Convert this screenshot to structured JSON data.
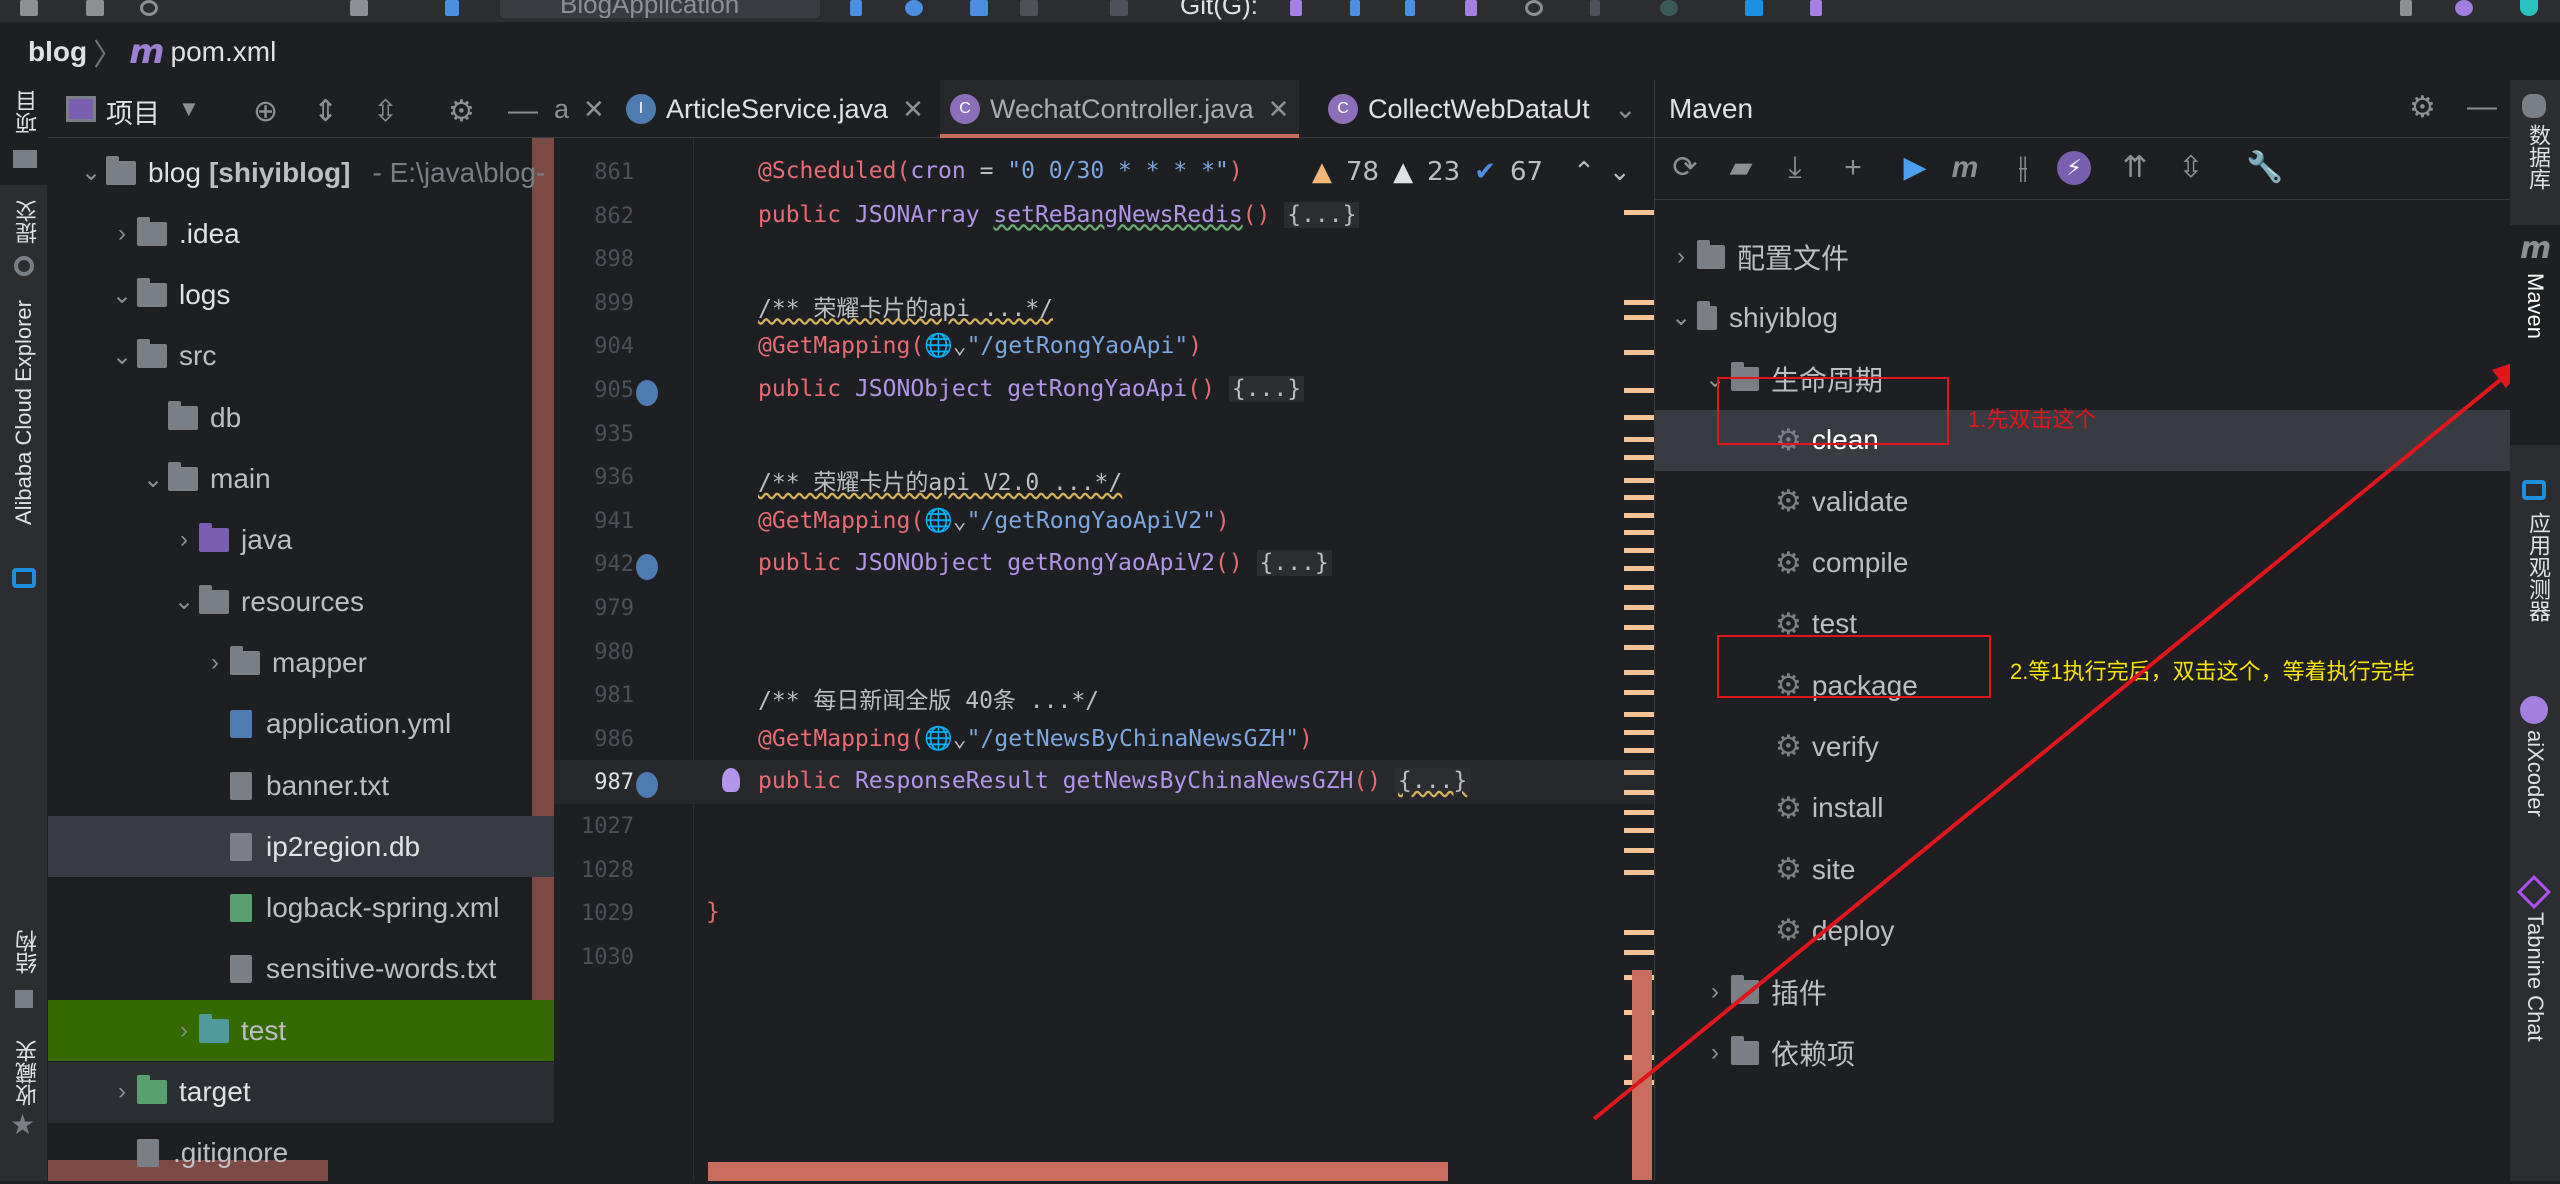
{
  "topbar": {
    "run_config": "BlogApplication",
    "vcs_label": "Git(G):"
  },
  "breadcrumb": {
    "root": "blog",
    "separator": "〉",
    "maven_icon": "m",
    "file": "pom.xml"
  },
  "left_strip": {
    "items": [
      {
        "label": "项目",
        "icon": "folder-icon"
      },
      {
        "label": "提交",
        "icon": "commit-icon"
      },
      {
        "label": "Alibaba Cloud Explorer",
        "icon": "alibaba-cloud-icon"
      },
      {
        "label": "结构",
        "icon": "structure-icon"
      },
      {
        "label": "收藏夹",
        "icon": "star-icon"
      }
    ]
  },
  "project": {
    "title": "项目",
    "tree": [
      {
        "name": "blog",
        "suffix": "[shiyiblog]",
        "path": "- E:\\java\\blog-",
        "expanded": true,
        "depth": 0,
        "type": "module"
      },
      {
        "name": ".idea",
        "expanded": false,
        "depth": 1,
        "type": "folder"
      },
      {
        "name": "logs",
        "expanded": true,
        "depth": 1,
        "type": "folder"
      },
      {
        "name": "src",
        "expanded": true,
        "depth": 1,
        "type": "folder"
      },
      {
        "name": "db",
        "depth": 2,
        "type": "folder"
      },
      {
        "name": "main",
        "expanded": true,
        "depth": 2,
        "type": "folder"
      },
      {
        "name": "java",
        "expanded": false,
        "depth": 3,
        "type": "source-folder"
      },
      {
        "name": "resources",
        "expanded": true,
        "depth": 3,
        "type": "resources-folder"
      },
      {
        "name": "mapper",
        "expanded": false,
        "depth": 4,
        "type": "folder"
      },
      {
        "name": "application.yml",
        "depth": 4,
        "type": "spring-yml"
      },
      {
        "name": "banner.txt",
        "depth": 4,
        "type": "spring-txt"
      },
      {
        "name": "ip2region.db",
        "depth": 4,
        "type": "unknown-file",
        "selected": true
      },
      {
        "name": "logback-spring.xml",
        "depth": 4,
        "type": "xml-file"
      },
      {
        "name": "sensitive-words.txt",
        "depth": 4,
        "type": "text-file"
      },
      {
        "name": "test",
        "expanded": false,
        "depth": 3,
        "type": "test-folder",
        "highlight": "green"
      },
      {
        "name": "target",
        "expanded": false,
        "depth": 1,
        "type": "excluded-folder"
      },
      {
        "name": ".gitignore",
        "depth": 1,
        "type": "ignore-file"
      }
    ]
  },
  "editor": {
    "tabs": [
      {
        "label": "a",
        "partial": true
      },
      {
        "label": "ArticleService.java",
        "icon": "I",
        "icon_color": "#4e7bb0"
      },
      {
        "label": "WechatController.java",
        "icon": "C",
        "icon_color": "#8c6fb8",
        "active": true
      },
      {
        "label": "CollectWebDataUt",
        "icon": "C",
        "icon_color": "#8c6fb8",
        "partial": true
      }
    ],
    "inspections": {
      "warnings": "78",
      "weak_warnings": "23",
      "typos": "67"
    },
    "lines": [
      {
        "no": "861",
        "parts": [
          [
            "an",
            "@Scheduled("
          ],
          [
            "ty",
            "cron"
          ],
          [
            "cm",
            " = "
          ],
          [
            "str",
            "\"0 0/30 * * * *\""
          ],
          [
            "pn",
            ")"
          ]
        ]
      },
      {
        "no": "862",
        "parts": [
          [
            "kw",
            "public "
          ],
          [
            "ty",
            "JSONArray "
          ],
          [
            "fnw",
            "setReBangNewsRedis"
          ],
          [
            "pn",
            "()"
          ],
          [
            "cm",
            " "
          ],
          [
            "fold",
            "{...}"
          ]
        ]
      },
      {
        "no": "898",
        "parts": []
      },
      {
        "no": "899",
        "parts": [
          [
            "cmw",
            "/** 荣耀卡片的api ...*/"
          ]
        ]
      },
      {
        "no": "904",
        "parts": [
          [
            "an",
            "@GetMapping("
          ],
          [
            "cm",
            "🌐⌄"
          ],
          [
            "str",
            "\"/getRongYaoApi\""
          ],
          [
            "pn",
            ")"
          ]
        ]
      },
      {
        "no": "905",
        "parts": [
          [
            "kw",
            "public "
          ],
          [
            "ty",
            "JSONObject "
          ],
          [
            "fn",
            "getRongYaoApi"
          ],
          [
            "pn",
            "()"
          ],
          [
            "cm",
            " "
          ],
          [
            "fold",
            "{...}"
          ]
        ],
        "gutter_icon": true
      },
      {
        "no": "935",
        "parts": []
      },
      {
        "no": "936",
        "parts": [
          [
            "cmw",
            "/** 荣耀卡片的api V2.0 ...*/"
          ]
        ]
      },
      {
        "no": "941",
        "parts": [
          [
            "an",
            "@GetMapping("
          ],
          [
            "cm",
            "🌐⌄"
          ],
          [
            "str",
            "\"/getRongYaoApiV2\""
          ],
          [
            "pn",
            ")"
          ]
        ]
      },
      {
        "no": "942",
        "parts": [
          [
            "kw",
            "public "
          ],
          [
            "ty",
            "JSONObject "
          ],
          [
            "fn",
            "getRongYaoApiV2"
          ],
          [
            "pn",
            "()"
          ],
          [
            "cm",
            " "
          ],
          [
            "fold",
            "{...}"
          ]
        ],
        "gutter_icon": true
      },
      {
        "no": "979",
        "parts": []
      },
      {
        "no": "980",
        "parts": []
      },
      {
        "no": "981",
        "parts": [
          [
            "cm",
            "/** 每日新闻全版 40条 ...*/"
          ]
        ]
      },
      {
        "no": "986",
        "parts": [
          [
            "an",
            "@GetMapping("
          ],
          [
            "cm",
            "🌐⌄"
          ],
          [
            "str",
            "\"/getNewsByChinaNewsGZH\""
          ],
          [
            "pn",
            ")"
          ]
        ]
      },
      {
        "no": "987",
        "parts": [
          [
            "kw",
            "public "
          ],
          [
            "ty",
            "ResponseResult "
          ],
          [
            "fn",
            "getNewsByChinaNewsGZH"
          ],
          [
            "pn",
            "()"
          ],
          [
            "cm",
            " "
          ],
          [
            "foldw",
            "{...}"
          ]
        ],
        "gutter_icon": true,
        "current": true
      },
      {
        "no": "1027",
        "parts": []
      },
      {
        "no": "1028",
        "parts": []
      },
      {
        "no": "1029",
        "parts": [
          [
            "pn",
            "}"
          ]
        ],
        "indent0": true
      },
      {
        "no": "1030",
        "parts": []
      }
    ]
  },
  "maven": {
    "title": "Maven",
    "tree": [
      {
        "label": "配置文件",
        "depth": 0,
        "expanded": false,
        "icon": "profiles-icon"
      },
      {
        "label": "shiyiblog",
        "depth": 0,
        "expanded": true,
        "icon": "maven-project-icon"
      },
      {
        "label": "生命周期",
        "depth": 1,
        "expanded": true,
        "icon": "lifecycle-icon"
      },
      {
        "label": "clean",
        "depth": 2,
        "icon": "gear-icon",
        "selected": true
      },
      {
        "label": "validate",
        "depth": 2,
        "icon": "gear-icon"
      },
      {
        "label": "compile",
        "depth": 2,
        "icon": "gear-icon"
      },
      {
        "label": "test",
        "depth": 2,
        "icon": "gear-icon"
      },
      {
        "label": "package",
        "depth": 2,
        "icon": "gear-icon"
      },
      {
        "label": "verify",
        "depth": 2,
        "icon": "gear-icon"
      },
      {
        "label": "install",
        "depth": 2,
        "icon": "gear-icon"
      },
      {
        "label": "site",
        "depth": 2,
        "icon": "gear-icon"
      },
      {
        "label": "deploy",
        "depth": 2,
        "icon": "gear-icon"
      },
      {
        "label": "插件",
        "depth": 1,
        "expanded": false,
        "icon": "plugins-icon"
      },
      {
        "label": "依赖项",
        "depth": 1,
        "expanded": false,
        "icon": "dependencies-icon"
      }
    ]
  },
  "annotations": {
    "step1": "1.先双击这个",
    "step2": "2.等1执行完后，双击这个，等着执行完毕",
    "step1_color": "#e0161b",
    "step2_color": "#f5e500"
  },
  "right_strip": {
    "items": [
      {
        "label": "数据库",
        "icon": "database-icon"
      },
      {
        "label": "Maven",
        "icon": "maven-icon",
        "active": true
      },
      {
        "label": "应用观测器",
        "icon": "alibaba-cloud-icon"
      },
      {
        "label": "aiXcoder",
        "icon": "aixcoder-icon"
      },
      {
        "label": "Tabnine Chat",
        "icon": "tabnine-icon"
      }
    ]
  }
}
